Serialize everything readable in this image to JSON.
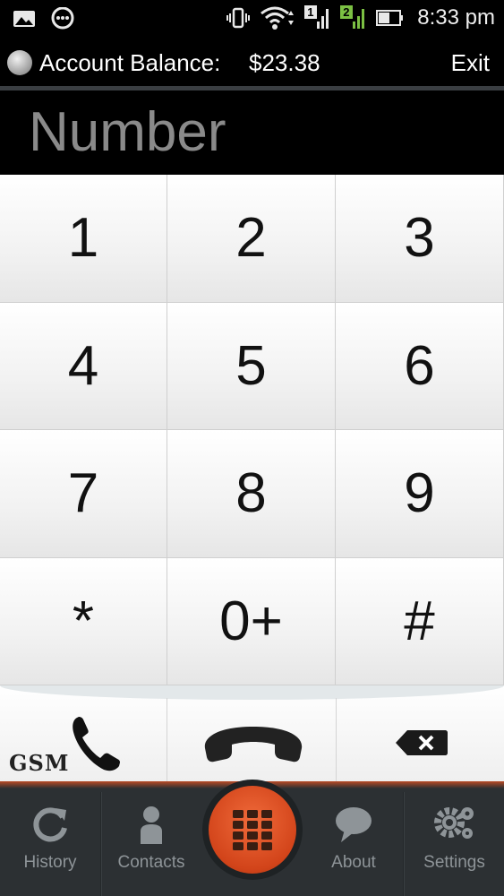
{
  "status_bar": {
    "time": "8:33 pm",
    "sim1_label": "1",
    "sim2_label": "2",
    "icons": [
      "gallery-icon",
      "chat-bubble-icon",
      "vibrate-icon",
      "wifi-icon",
      "signal-sim1-icon",
      "signal-sim2-icon",
      "battery-icon"
    ]
  },
  "account": {
    "label": "Account Balance:",
    "value": "$23.38",
    "exit_label": "Exit"
  },
  "number_field": {
    "placeholder": "Number",
    "value": ""
  },
  "keypad": {
    "keys": [
      "1",
      "2",
      "3",
      "4",
      "5",
      "6",
      "7",
      "8",
      "9",
      "*",
      "0+",
      "#"
    ]
  },
  "actions": {
    "gsm_label": "GSM",
    "icons": [
      "gsm-phone-icon",
      "call-handset-icon",
      "backspace-icon"
    ]
  },
  "bottom_nav": {
    "items": [
      {
        "label": "History",
        "icon": "refresh-icon"
      },
      {
        "label": "Contacts",
        "icon": "person-icon"
      },
      {
        "label": "About",
        "icon": "chat-bubble-icon"
      },
      {
        "label": "Settings",
        "icon": "gears-icon"
      }
    ],
    "center_icon": "dialpad-grid-icon"
  },
  "colors": {
    "accent": "#e2542a",
    "nav_bg": "#2c3033",
    "nav_text": "#8e9498",
    "sim2_green": "#7bc043"
  }
}
